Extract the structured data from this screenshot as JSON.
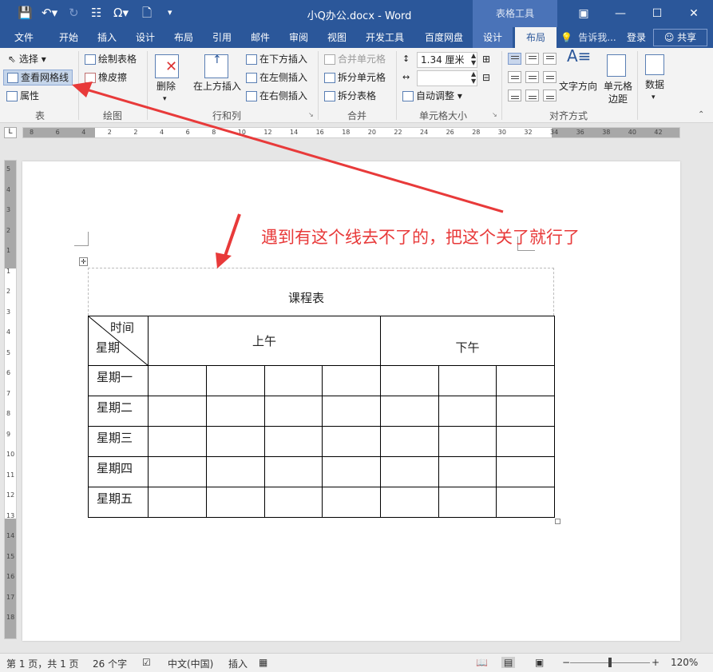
{
  "window": {
    "doc_title": "小Q办公.docx - Word",
    "context_tab_group": "表格工具",
    "controls": [
      "minimize",
      "maximize",
      "close",
      "ribbon-display"
    ]
  },
  "tabs": [
    {
      "label": "文件"
    },
    {
      "label": "开始"
    },
    {
      "label": "插入"
    },
    {
      "label": "设计"
    },
    {
      "label": "布局"
    },
    {
      "label": "引用"
    },
    {
      "label": "邮件"
    },
    {
      "label": "审阅"
    },
    {
      "label": "视图"
    },
    {
      "label": "开发工具"
    },
    {
      "label": "百度网盘"
    },
    {
      "label": "设计"
    },
    {
      "label": "布局"
    }
  ],
  "tell_me": "告诉我...",
  "login": "登录",
  "share": "共享",
  "ribbon": {
    "table_group": {
      "label": "表",
      "select": "选择",
      "view_gridlines": "查看网格线",
      "properties": "属性"
    },
    "draw_group": {
      "label": "绘图",
      "draw_table": "绘制表格",
      "eraser": "橡皮擦"
    },
    "rows_cols_group": {
      "label": "行和列",
      "delete": "删除",
      "insert_above": "在上方插入",
      "insert_below": "在下方插入",
      "insert_left": "在左侧插入",
      "insert_right": "在右侧插入"
    },
    "merge_group": {
      "label": "合并",
      "merge_cells": "合并单元格",
      "split_cells": "拆分单元格",
      "split_table": "拆分表格"
    },
    "cell_size_group": {
      "label": "单元格大小",
      "height_value": "1.34 厘米",
      "width_value": "",
      "autofit": "自动调整"
    },
    "alignment_group": {
      "label": "对齐方式",
      "text_direction": "文字方向",
      "cell_margins": "单元格边距"
    },
    "data_group": {
      "label": "数据"
    }
  },
  "ruler_ticks": [
    "8",
    "6",
    "4",
    "2",
    "2",
    "4",
    "6",
    "8",
    "10",
    "12",
    "14",
    "16",
    "18",
    "20",
    "22",
    "24",
    "26",
    "28",
    "30",
    "32",
    "34",
    "36",
    "38",
    "40",
    "42"
  ],
  "vruler_ticks": [
    "5",
    "4",
    "3",
    "2",
    "1",
    "1",
    "2",
    "3",
    "4",
    "5",
    "6",
    "7",
    "8",
    "9",
    "10",
    "11",
    "12",
    "13",
    "14",
    "15",
    "16",
    "17",
    "18"
  ],
  "document": {
    "caption": "课程表",
    "header_time": "时间",
    "header_day": "星期",
    "morning": "上午",
    "afternoon": "下午",
    "days": [
      "星期一",
      "星期二",
      "星期三",
      "星期四",
      "星期五"
    ]
  },
  "annotation": {
    "text": "遇到有这个线去不了的，把这个关了就行了",
    "color": "#e83a3a"
  },
  "statusbar": {
    "page": "第 1 页，共 1 页",
    "words": "26 个字",
    "language": "中文(中国)",
    "mode": "插入",
    "zoom": "120%"
  },
  "colors": {
    "accent": "#2b579a",
    "context": "#4a73b8",
    "annotation": "#e83a3a"
  }
}
